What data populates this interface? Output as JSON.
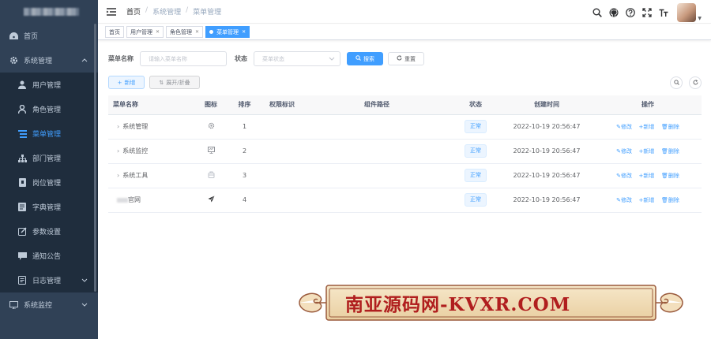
{
  "sidebar": {
    "items": [
      {
        "label": "首页",
        "icon": "dashboard-icon"
      },
      {
        "label": "系统管理",
        "icon": "gear-icon"
      },
      {
        "label": "用户管理",
        "icon": "user-icon"
      },
      {
        "label": "角色管理",
        "icon": "role-icon"
      },
      {
        "label": "菜单管理",
        "icon": "tree-table-icon"
      },
      {
        "label": "部门管理",
        "icon": "tree-icon"
      },
      {
        "label": "岗位管理",
        "icon": "post-icon"
      },
      {
        "label": "字典管理",
        "icon": "dict-icon"
      },
      {
        "label": "参数设置",
        "icon": "edit-icon"
      },
      {
        "label": "通知公告",
        "icon": "message-icon"
      },
      {
        "label": "日志管理",
        "icon": "log-icon"
      },
      {
        "label": "系统监控",
        "icon": "monitor-icon"
      }
    ]
  },
  "breadcrumb": {
    "home": "首页",
    "level1": "系统管理",
    "level2": "菜单管理",
    "sep": "/"
  },
  "tags": [
    {
      "label": "首页"
    },
    {
      "label": "用户管理"
    },
    {
      "label": "角色管理"
    },
    {
      "label": "菜单管理"
    }
  ],
  "search": {
    "name_label": "菜单名称",
    "name_placeholder": "请输入菜单名称",
    "status_label": "状态",
    "status_placeholder": "菜单状态",
    "search_btn": "搜索",
    "reset_btn": "重置"
  },
  "toolbar": {
    "add_btn": "新增",
    "expand_btn": "展开/折叠"
  },
  "table": {
    "headers": [
      "菜单名称",
      "图标",
      "排序",
      "权限标识",
      "组件路径",
      "状态",
      "创建时间",
      "操作"
    ],
    "rows": [
      {
        "name": "系统管理",
        "icon": "gear-icon",
        "order": "1",
        "status": "正常",
        "time": "2022-10-19 20:56:47",
        "expandable": true
      },
      {
        "name": "系统监控",
        "icon": "monitor-icon",
        "order": "2",
        "status": "正常",
        "time": "2022-10-19 20:56:47",
        "expandable": true
      },
      {
        "name": "系统工具",
        "icon": "tool-icon",
        "order": "3",
        "status": "正常",
        "time": "2022-10-19 20:56:47",
        "expandable": true
      },
      {
        "name": "官网",
        "icon": "send-icon",
        "order": "4",
        "status": "正常",
        "time": "2022-10-19 20:56:47",
        "expandable": false
      }
    ],
    "ops": {
      "edit": "修改",
      "add": "新增",
      "delete": "删除"
    }
  },
  "watermark": "南亚源码网-KVXR.COM",
  "colors": {
    "sidebar_bg": "#304156",
    "submenu_bg": "#1f2d3d",
    "primary": "#409eff",
    "watermark": "#b01e1e"
  }
}
